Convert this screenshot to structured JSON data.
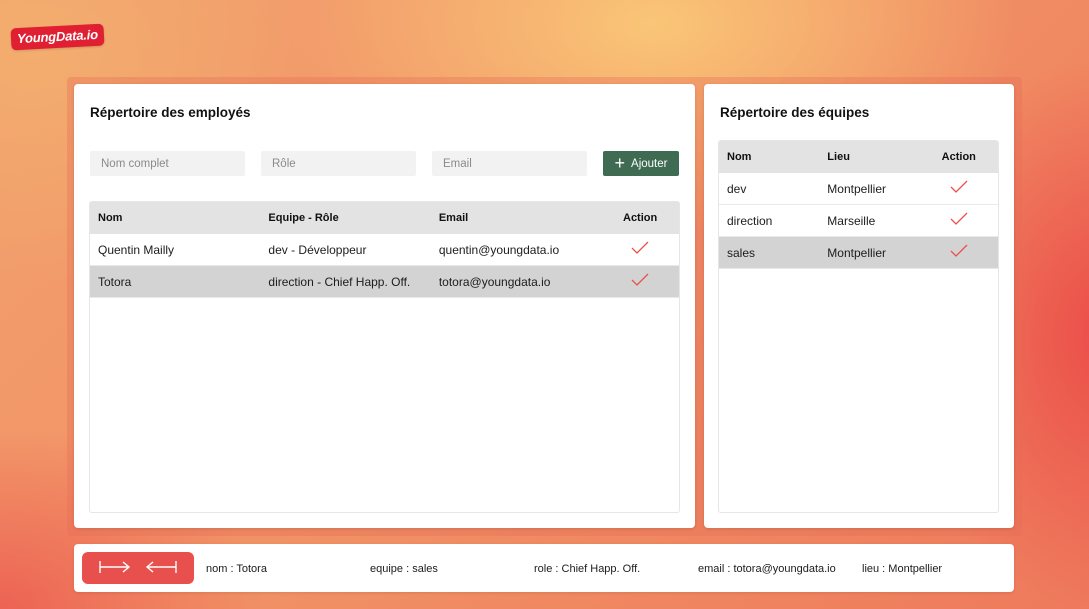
{
  "brand": {
    "logo_text": "YoungData.io"
  },
  "employees": {
    "title": "Répertoire des employés",
    "form": {
      "name_placeholder": "Nom complet",
      "role_placeholder": "Rôle",
      "email_placeholder": "Email",
      "add_label": "Ajouter"
    },
    "columns": [
      "Nom",
      "Equipe - Rôle",
      "Email",
      "Action"
    ],
    "rows": [
      {
        "nom": "Quentin Mailly",
        "equipe_role": "dev - Développeur",
        "email": "quentin@youngdata.io",
        "selected": false
      },
      {
        "nom": "Totora",
        "equipe_role": "direction - Chief Happ. Off.",
        "email": "totora@youngdata.io",
        "selected": true
      }
    ]
  },
  "teams": {
    "title": "Répertoire des équipes",
    "columns": [
      "Nom",
      "Lieu",
      "Action"
    ],
    "rows": [
      {
        "nom": "dev",
        "lieu": "Montpellier",
        "selected": false
      },
      {
        "nom": "direction",
        "lieu": "Marseille",
        "selected": false
      },
      {
        "nom": "sales",
        "lieu": "Montpellier",
        "selected": true
      }
    ]
  },
  "footer": {
    "nom": "nom : Totora",
    "equipe": "equipe : sales",
    "role": "role : Chief Happ. Off.",
    "email": "email : totora@youngdata.io",
    "lieu": "lieu : Montpellier"
  },
  "icons": {
    "action": "check-icon",
    "add": "plus-icon",
    "swap": "swap-arrows-icon"
  },
  "colors": {
    "accent": "#e8504d",
    "add_button": "#3f6b52",
    "check": "#e8504d",
    "logo_bg": "#e01f33"
  }
}
